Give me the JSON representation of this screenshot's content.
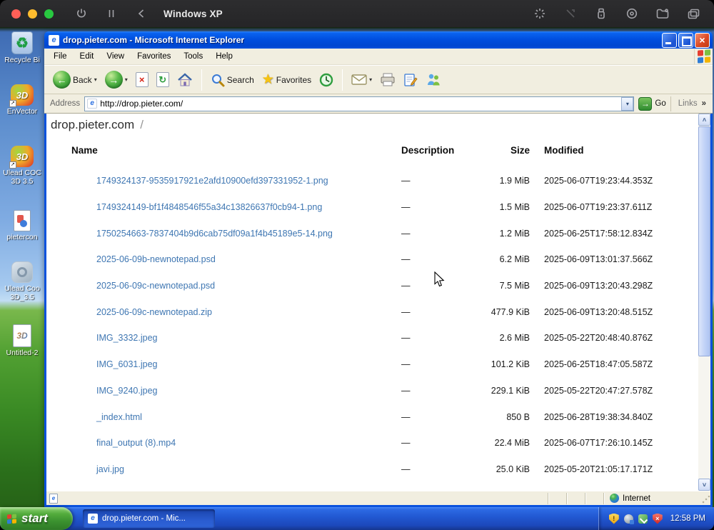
{
  "vm_titlebar": {
    "title": "Windows XP",
    "left_icons": [
      "power-icon",
      "pause-icon",
      "back-icon"
    ],
    "right_icons": [
      "spinner-icon",
      "capture-disabled-icon",
      "usb-icon",
      "disc-icon",
      "shared-folder-icon",
      "displays-icon"
    ]
  },
  "desktop": {
    "icons": [
      {
        "type": "recycle-bin",
        "label": "Recycle Bi"
      },
      {
        "type": "cool3d",
        "label": "EnVector",
        "shortcut": true
      },
      {
        "type": "cool3d",
        "label": "Ulead COC\n3D 3.5",
        "shortcut": true
      },
      {
        "type": "image-file",
        "label": "pietercon"
      },
      {
        "type": "gray-app",
        "label": "Ulead Coo\n3D_3.5"
      },
      {
        "type": "doc-3d",
        "label": "Untitled-2"
      }
    ]
  },
  "ie": {
    "title": "drop.pieter.com - Microsoft Internet Explorer",
    "menus": [
      "File",
      "Edit",
      "View",
      "Favorites",
      "Tools",
      "Help"
    ],
    "toolbar": {
      "back": "Back",
      "search": "Search",
      "favorites": "Favorites"
    },
    "address": {
      "label": "Address",
      "value": "http://drop.pieter.com/",
      "go": "Go",
      "links": "Links"
    },
    "status_zone": "Internet"
  },
  "page": {
    "heading": "drop.pieter.com",
    "heading_suffix": "/",
    "columns": [
      "Name",
      "Description",
      "Size",
      "Modified"
    ],
    "files": [
      {
        "name": "1749324137-9535917921e2afd10900efd397331952-1.png",
        "description": "—",
        "size": "1.9 MiB",
        "modified": "2025-06-07T19:23:44.353Z"
      },
      {
        "name": "1749324149-bf1f4848546f55a34c13826637f0cb94-1.png",
        "description": "—",
        "size": "1.5 MiB",
        "modified": "2025-06-07T19:23:37.611Z"
      },
      {
        "name": "1750254663-7837404b9d6cab75df09a1f4b45189e5-14.png",
        "description": "—",
        "size": "1.2 MiB",
        "modified": "2025-06-25T17:58:12.834Z"
      },
      {
        "name": "2025-06-09b-newnotepad.psd",
        "description": "—",
        "size": "6.2 MiB",
        "modified": "2025-06-09T13:01:37.566Z"
      },
      {
        "name": "2025-06-09c-newnotepad.psd",
        "description": "—",
        "size": "7.5 MiB",
        "modified": "2025-06-09T13:20:43.298Z"
      },
      {
        "name": "2025-06-09c-newnotepad.zip",
        "description": "—",
        "size": "477.9 KiB",
        "modified": "2025-06-09T13:20:48.515Z"
      },
      {
        "name": "IMG_3332.jpeg",
        "description": "—",
        "size": "2.6 MiB",
        "modified": "2025-05-22T20:48:40.876Z"
      },
      {
        "name": "IMG_6031.jpeg",
        "description": "—",
        "size": "101.2 KiB",
        "modified": "2025-06-25T18:47:05.587Z"
      },
      {
        "name": "IMG_9240.jpeg",
        "description": "—",
        "size": "229.1 KiB",
        "modified": "2025-05-22T20:47:27.578Z"
      },
      {
        "name": "_index.html",
        "description": "—",
        "size": "850 B",
        "modified": "2025-06-28T19:38:34.840Z"
      },
      {
        "name": "final_output (8).mp4",
        "description": "—",
        "size": "22.4 MiB",
        "modified": "2025-06-07T17:26:10.145Z"
      },
      {
        "name": "javi.jpg",
        "description": "—",
        "size": "25.0 KiB",
        "modified": "2025-05-20T21:05:17.171Z"
      }
    ]
  },
  "taskbar": {
    "start": "start",
    "task": "drop.pieter.com - Mic...",
    "time": "12:58 PM",
    "tray_icons": [
      "security-warning-tray-icon",
      "hardware-tray-icon",
      "update-tray-icon",
      "security-alert-tray-icon"
    ]
  },
  "glyphs": {
    "back_arrow": "←",
    "forward_arrow": "→",
    "stop_x": "×",
    "refresh": "↻",
    "dropdown": "▾",
    "star": "★",
    "links_overflow": "»",
    "close_x": "×",
    "recycle": "♻",
    "ie_e": "e",
    "up_chevron": "˄",
    "down_chevron": "˅",
    "shortcut": "➚",
    "shield_warn_mark": "!",
    "shield_alert_mark": "×",
    "three_d": "3D"
  },
  "colors": {
    "link": "#3e76b2",
    "titlebar_blue": "#004fdf",
    "taskbar_blue": "#2259d3",
    "start_green": "#3c9330",
    "menu_bg": "#f1eee0"
  }
}
